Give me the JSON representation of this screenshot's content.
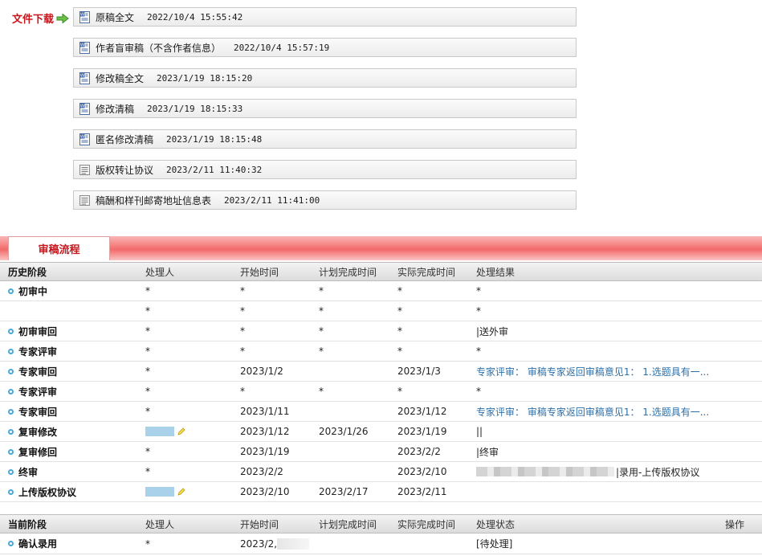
{
  "downloads": {
    "label": "文件下载",
    "files": [
      {
        "name": "原稿全文",
        "time": "2022/10/4 15:55:42",
        "icon": "word-doc-icon"
      },
      {
        "name": "作者盲审稿（不含作者信息）",
        "time": "2022/10/4 15:57:19",
        "icon": "word-doc-icon"
      },
      {
        "name": "修改稿全文",
        "time": "2023/1/19 18:15:20",
        "icon": "word-doc-icon"
      },
      {
        "name": "修改清稿",
        "time": "2023/1/19 18:15:33",
        "icon": "word-doc-icon"
      },
      {
        "name": "匿名修改清稿",
        "time": "2023/1/19 18:15:48",
        "icon": "word-doc-icon"
      },
      {
        "name": "版权转让协议",
        "time": "2023/2/11 11:40:32",
        "icon": "generic-doc-icon"
      },
      {
        "name": "稿酬和样刊邮寄地址信息表",
        "time": "2023/2/11 11:41:00",
        "icon": "generic-doc-icon"
      }
    ]
  },
  "tab": {
    "label": "审稿流程"
  },
  "history": {
    "headers": [
      "历史阶段",
      "处理人",
      "开始时间",
      "计划完成时间",
      "实际完成时间",
      "处理结果"
    ],
    "rows": [
      {
        "stage": "初审中",
        "handler": "*",
        "start": "*",
        "plan": "*",
        "actual": "*",
        "result": "*"
      },
      {
        "stage": "",
        "handler": "*",
        "start": "*",
        "plan": "*",
        "actual": "*",
        "result": "*"
      },
      {
        "stage": "初审审回",
        "handler": "*",
        "start": "*",
        "plan": "*",
        "actual": "*",
        "result": "|送外审"
      },
      {
        "stage": "专家评审",
        "handler": "*",
        "start": "*",
        "plan": "*",
        "actual": "*",
        "result": "*"
      },
      {
        "stage": "专家审回",
        "handler": "*",
        "start": "2023/1/2",
        "plan": "",
        "actual": "2023/1/3",
        "result": "专家评审： 审稿专家返回审稿意见1： 1.选题具有一..."
      },
      {
        "stage": "专家评审",
        "handler": "*",
        "start": "*",
        "plan": "*",
        "actual": "*",
        "result": "*"
      },
      {
        "stage": "专家审回",
        "handler": "*",
        "start": "2023/1/11",
        "plan": "",
        "actual": "2023/1/12",
        "result": "专家评审： 审稿专家返回审稿意见1： 1.选题具有一..."
      },
      {
        "stage": "复审修改",
        "handler": "",
        "start": "2023/1/12",
        "plan": "2023/1/26",
        "actual": "2023/1/19",
        "result": "||"
      },
      {
        "stage": "复审修回",
        "handler": "*",
        "start": "2023/1/19",
        "plan": "",
        "actual": "2023/2/2",
        "result": "|终审"
      },
      {
        "stage": "终审",
        "handler": "*",
        "start": "2023/2/2",
        "plan": "",
        "actual": "2023/2/10",
        "result": "|录用-上传版权协议"
      },
      {
        "stage": "上传版权协议",
        "handler": "",
        "start": "2023/2/10",
        "plan": "2023/2/17",
        "actual": "2023/2/11",
        "result": ""
      }
    ]
  },
  "current": {
    "headers": [
      "当前阶段",
      "处理人",
      "开始时间",
      "计划完成时间",
      "实际完成时间",
      "处理状态",
      "操作"
    ],
    "rows": [
      {
        "stage": "确认录用",
        "handler": "*",
        "start": "2023/2,",
        "plan": "",
        "actual": "",
        "status": "[待处理]"
      }
    ]
  },
  "colors": {
    "accent_red": "#c8161d",
    "link_blue": "#2d6fa8",
    "bullet_blue": "#48a9d8"
  }
}
